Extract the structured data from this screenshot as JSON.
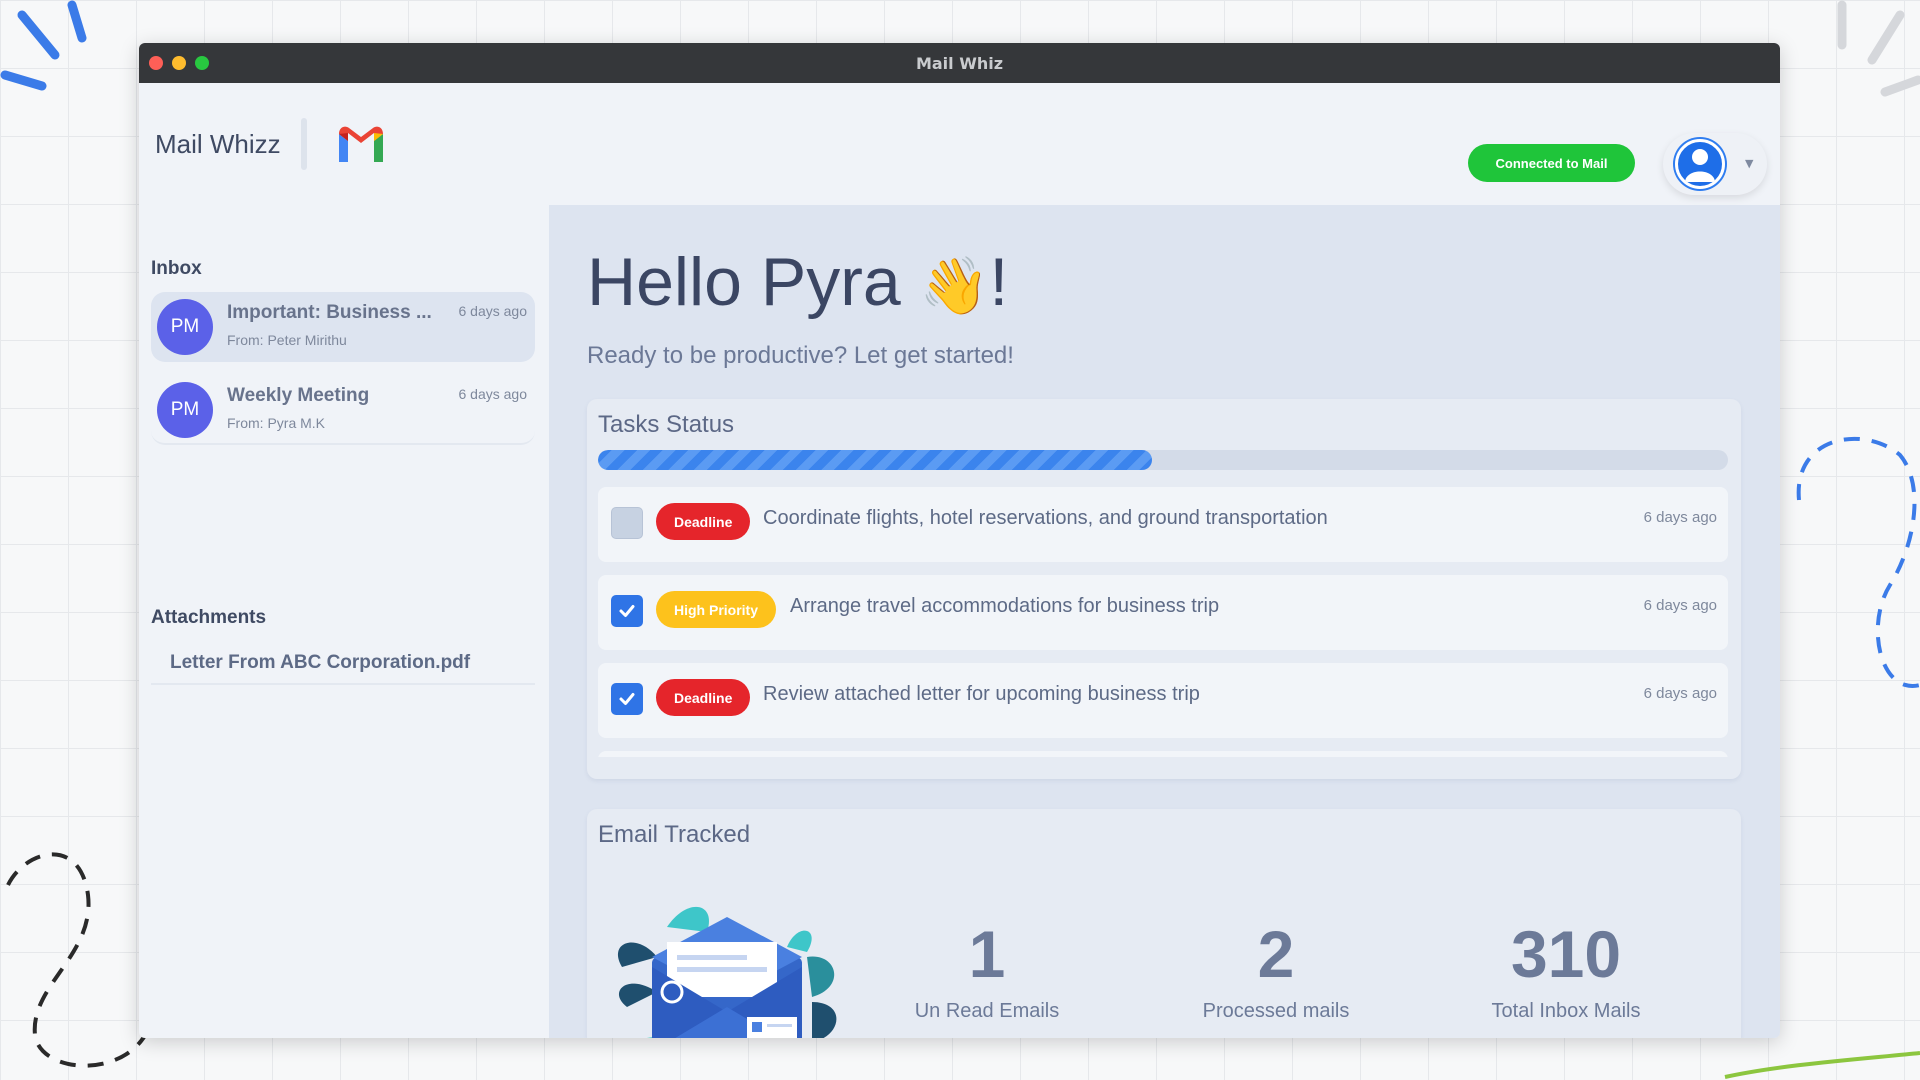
{
  "window": {
    "title": "Mail Whiz"
  },
  "header": {
    "brand": "Mail Whizz",
    "logo_icon": "gmail-logo-icon",
    "connection_label": "Connected to Mail",
    "connection_color": "#1fc53a",
    "user_icon": "user-avatar-icon"
  },
  "sidebar": {
    "inbox_title": "Inbox",
    "mails": [
      {
        "initials": "PM",
        "subject": "Important: Business ...",
        "from": "From: Peter Mirithu",
        "time": "6 days ago",
        "selected": true
      },
      {
        "initials": "PM",
        "subject": "Weekly Meeting",
        "from": "From: Pyra M.K",
        "time": "6 days ago",
        "selected": false
      }
    ],
    "attachments_title": "Attachments",
    "attachments": [
      "Letter From ABC Corporation.pdf"
    ]
  },
  "main": {
    "greeting": "Hello Pyra",
    "greeting_emoji": "👋",
    "greeting_punct": "!",
    "subtitle": "Ready to be productive? Let get started!",
    "tasks": {
      "title": "Tasks Status",
      "progress_fraction": 0.49,
      "items": [
        {
          "checked": false,
          "badge": "Deadline",
          "badge_color": "#e5252b",
          "text": "Coordinate flights, hotel reservations, and ground transportation",
          "time": "6 days ago"
        },
        {
          "checked": true,
          "badge": "High Priority",
          "badge_color": "#fdc21c",
          "text": "Arrange travel accommodations for business trip",
          "time": "6 days ago"
        },
        {
          "checked": true,
          "badge": "Deadline",
          "badge_color": "#e5252b",
          "text": "Review attached letter for upcoming business trip",
          "time": "6 days ago"
        }
      ]
    },
    "emails": {
      "title": "Email Tracked",
      "illustration_icon": "envelope-illustration-icon",
      "stats": [
        {
          "value": "1",
          "label": "Un Read Emails"
        },
        {
          "value": "2",
          "label": "Processed mails"
        },
        {
          "value": "310",
          "label": "Total Inbox Mails"
        }
      ]
    }
  }
}
